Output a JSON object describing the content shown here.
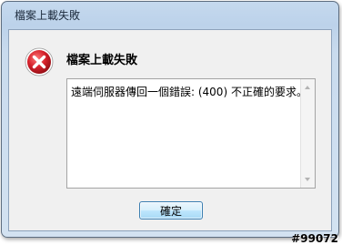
{
  "window": {
    "title": "檔案上載失敗"
  },
  "dialog": {
    "icon": "error-icon",
    "heading": "檔案上載失敗",
    "message": "遠端伺服器傳回一個錯誤: (400) 不正確的要求。",
    "ok_label": "確定"
  },
  "watermark": "#99072",
  "colors": {
    "error_red": "#d4202a",
    "button_border": "#3c7fb1"
  }
}
